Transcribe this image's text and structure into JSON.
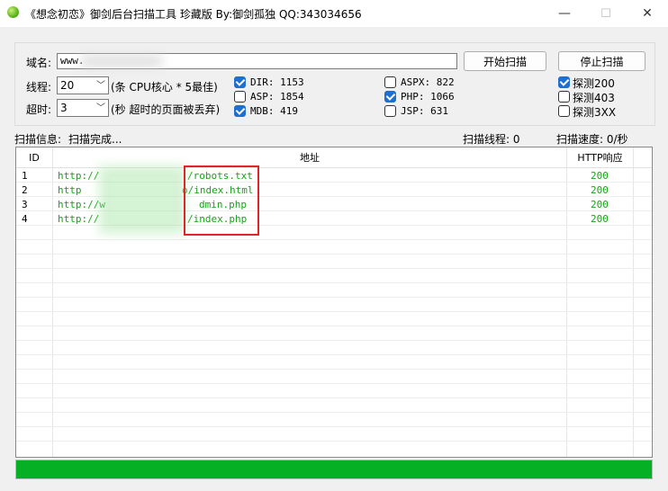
{
  "window": {
    "title": "《想念初恋》御剑后台扫描工具 珍藏版 By:御剑孤独 QQ:343034656",
    "minimize": "—",
    "maximize": "☐",
    "close": "✕"
  },
  "form": {
    "domain_label": "域名:",
    "domain_value": "www.",
    "threads_label": "线程:",
    "threads_value": "20",
    "threads_hint": "(条 CPU核心 * 5最佳)",
    "timeout_label": "超时:",
    "timeout_value": "3",
    "timeout_hint": "(秒 超时的页面被丢弃)",
    "start_button": "开始扫描",
    "stop_button": "停止扫描"
  },
  "dictionaries": [
    {
      "label": "DIR: 1153",
      "checked": true
    },
    {
      "label": "ASP: 1854",
      "checked": false
    },
    {
      "label": "MDB: 419",
      "checked": true
    },
    {
      "label": "ASPX: 822",
      "checked": false
    },
    {
      "label": "PHP: 1066",
      "checked": true
    },
    {
      "label": "JSP: 631",
      "checked": false
    }
  ],
  "detect": [
    {
      "label": "探测200",
      "checked": true
    },
    {
      "label": "探测403",
      "checked": false
    },
    {
      "label": "探测3XX",
      "checked": false
    }
  ],
  "status": {
    "info_label": "扫描信息:",
    "info_value": "扫描完成...",
    "threads": "扫描线程: 0",
    "speed": "扫描速度: 0/秒"
  },
  "table": {
    "columns": [
      "ID",
      "地址",
      "HTTP响应"
    ],
    "rows": [
      {
        "id": "1",
        "addr_prefix": "http://",
        "addr_suffix": "/robots.txt",
        "code": "200"
      },
      {
        "id": "2",
        "addr_prefix": "http",
        "addr_suffix": "o/index.html",
        "code": "200"
      },
      {
        "id": "3",
        "addr_prefix": "http://w",
        "addr_suffix": "dmin.php",
        "code": "200"
      },
      {
        "id": "4",
        "addr_prefix": "http://",
        "addr_suffix": "/index.php",
        "code": "200"
      }
    ]
  },
  "progress": {
    "value": 1.0
  },
  "colors": {
    "accent": "#1f6fd0",
    "ok_green": "#17a317",
    "progress": "#06b025",
    "highlight": "#e0242b"
  }
}
